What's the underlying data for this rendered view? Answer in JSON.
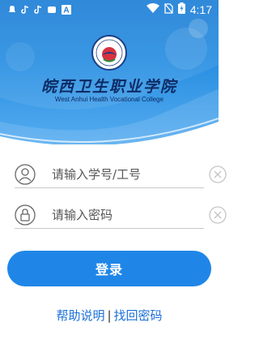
{
  "status_bar": {
    "time": "4:17",
    "icons": [
      "notification-icon",
      "tiktok-icon",
      "tiktok-icon",
      "message-icon",
      "app-a-icon",
      "wifi-icon",
      "no-sim-icon",
      "battery-charging-icon"
    ],
    "app_badge": "A"
  },
  "header": {
    "school_name_cn": "皖西卫生职业学院",
    "school_name_en": "West Anhui Health Vocational College",
    "colors": {
      "background": "#2a90e2",
      "title": "#0e2c66"
    }
  },
  "form": {
    "username": {
      "placeholder": "请输入学号/工号",
      "value": ""
    },
    "password": {
      "placeholder": "请输入密码",
      "value": ""
    }
  },
  "login_button": {
    "label": "登录",
    "color": "#1f86e8"
  },
  "links": {
    "help": "帮助说明",
    "separator": "|",
    "recover": "找回密码",
    "color": "#1a6fd8"
  }
}
